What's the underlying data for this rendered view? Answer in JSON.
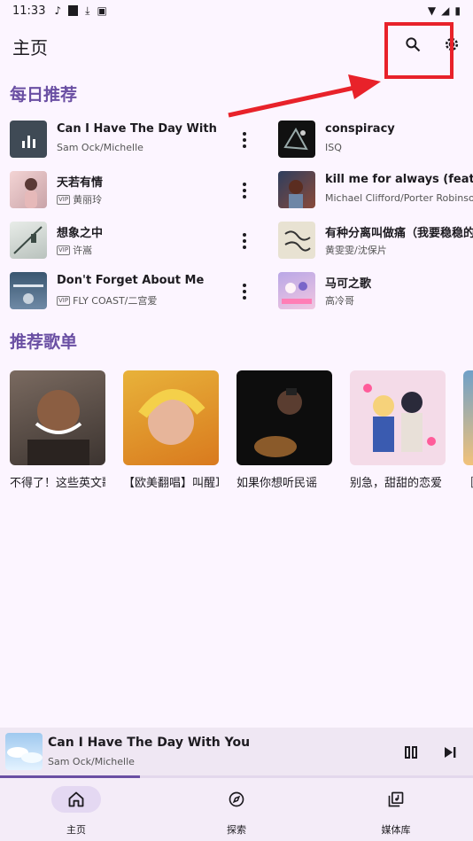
{
  "status": {
    "time": "11:33"
  },
  "app": {
    "title": "主页"
  },
  "sections": {
    "daily": "每日推荐",
    "playlists": "推荐歌单"
  },
  "songs": [
    {
      "title": "Can I Have The Day With You",
      "artist": "Sam Ock/Michelle",
      "vip": false
    },
    {
      "title": "天若有情",
      "artist": "黄丽玲",
      "vip": true
    },
    {
      "title": "想象之中",
      "artist": "许嵩",
      "vip": true
    },
    {
      "title": "Don't Forget About Me",
      "artist": "FLY COAST/二宫爱",
      "vip": true
    },
    {
      "title": "conspiracy",
      "artist": "ISQ",
      "vip": false
    },
    {
      "title": "kill me for always (feat. porter robinson)",
      "artist": "Michael Clifford/Porter Robinson",
      "vip": false
    },
    {
      "title": "有种分离叫做痛（我要稳稳的幸福）",
      "artist": "黄雯雯/沈保片",
      "vip": false
    },
    {
      "title": "马可之歌",
      "artist": "高冷哥",
      "vip": false
    }
  ],
  "vip_label": "VIP",
  "playlists": [
    {
      "title": "不得了！这些英文歌"
    },
    {
      "title": "【欧美翻唱】叫醒耳朵"
    },
    {
      "title": "如果你想听民谣"
    },
    {
      "title": "别急，甜甜的恋爱"
    },
    {
      "title": "［"
    }
  ],
  "now_playing": {
    "title": "Can I Have The Day With You",
    "artist": "Sam Ock/Michelle",
    "progress": 0.295
  },
  "nav": [
    {
      "label": "主页",
      "icon": "home-icon",
      "active": true
    },
    {
      "label": "探索",
      "icon": "compass-icon",
      "active": false
    },
    {
      "label": "媒体库",
      "icon": "library-icon",
      "active": false
    }
  ],
  "colors": {
    "accent": "#6a4fa3",
    "highlight": "#e8222a",
    "background": "#fcf5ff"
  }
}
